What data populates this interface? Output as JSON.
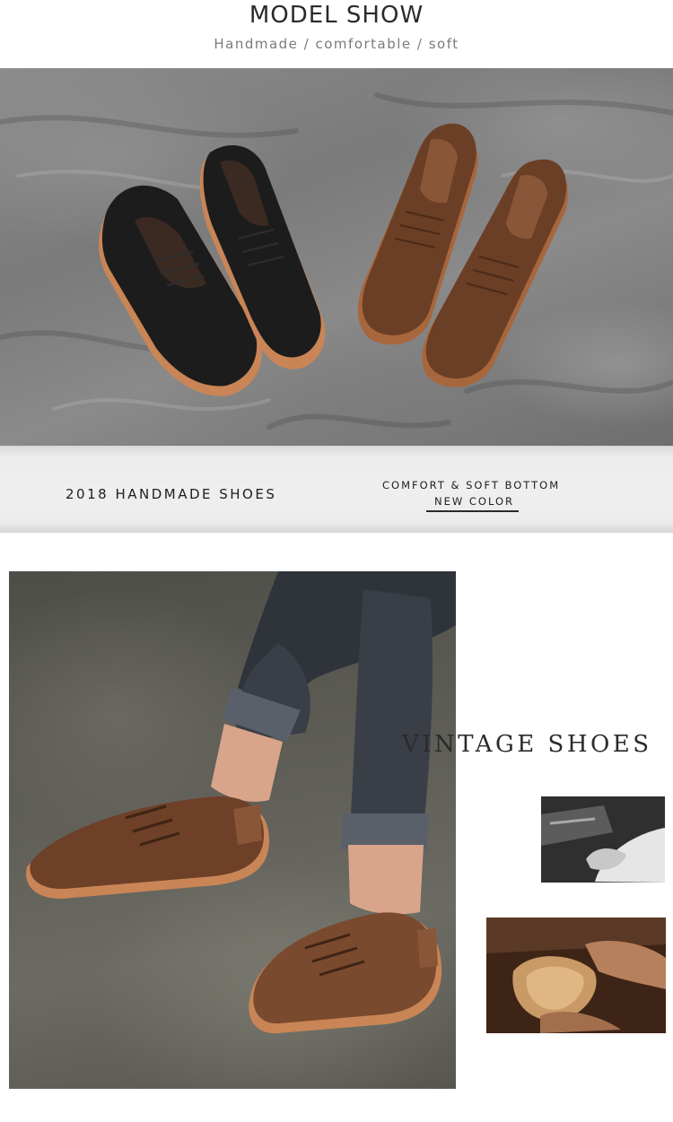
{
  "header": {
    "title": "MODEL SHOW",
    "subtitle": "Handmade / comfortable / soft"
  },
  "banner": {
    "left_text": "2018 HANDMADE SHOES",
    "right_line1": "COMFORT & SOFT BOTTOM",
    "right_line2": "NEW COLOR"
  },
  "vintage": {
    "text": "VINTAGE SHOES"
  },
  "colors": {
    "black_shoe": "#1c1c1c",
    "brown_shoe": "#6b3f26",
    "sole": "#c98556",
    "backdrop_gray": "#7e7e7e"
  }
}
